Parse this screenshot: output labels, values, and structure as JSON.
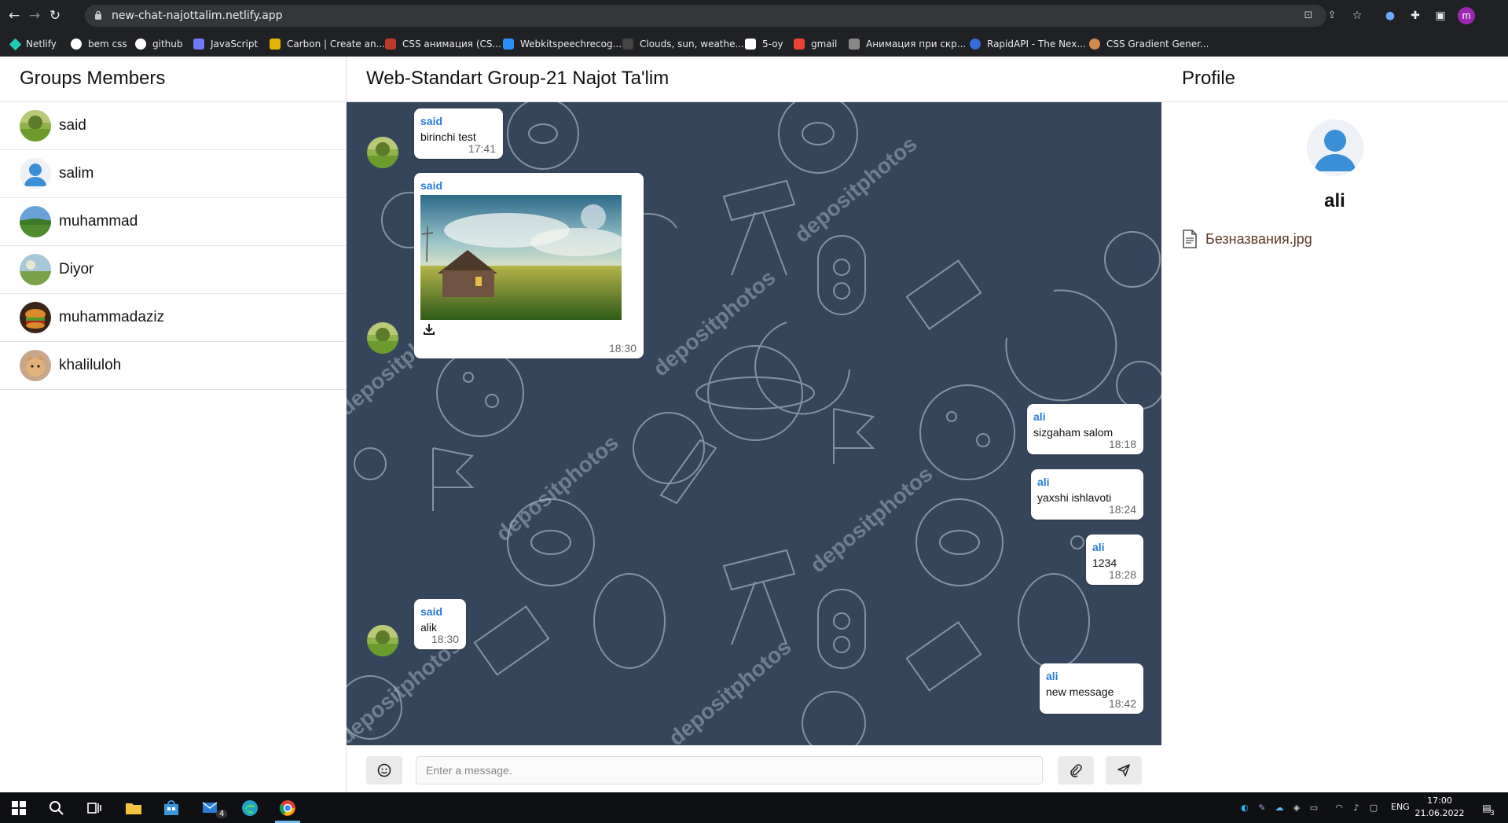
{
  "browser": {
    "url": "new-chat-najottalim.netlify.app",
    "profile_initial": "m",
    "bookmarks": [
      {
        "label": "Netlify",
        "color": "#25c7b7"
      },
      {
        "label": "bem css",
        "color": "#ffffff"
      },
      {
        "label": "github",
        "color": "#ffffff"
      },
      {
        "label": "JavaScript",
        "color": "#6f7bf7"
      },
      {
        "label": "Carbon | Create an...",
        "color": "#e0b400"
      },
      {
        "label": "CSS анимация (CS...",
        "color": "#c0392b"
      },
      {
        "label": "Webkitspeechrecog...",
        "color": "#2c8ef8"
      },
      {
        "label": "Clouds, sun, weathe...",
        "color": "#444444"
      },
      {
        "label": "5-oy",
        "color": "#ffffff"
      },
      {
        "label": "gmail",
        "color": "#ea4335"
      },
      {
        "label": "Анимация при скр...",
        "color": "#888888"
      },
      {
        "label": "RapidAPI - The Nex...",
        "color": "#3b6bd6"
      },
      {
        "label": "CSS Gradient Gener...",
        "color": "#d08a50"
      }
    ]
  },
  "members": {
    "title": "Groups Members",
    "list": [
      {
        "name": "said",
        "avatar": "landscape"
      },
      {
        "name": "salim",
        "avatar": "default-user"
      },
      {
        "name": "muhammad",
        "avatar": "landscape"
      },
      {
        "name": "Diyor",
        "avatar": "landscape"
      },
      {
        "name": "muhammadaziz",
        "avatar": "food"
      },
      {
        "name": "khaliluloh",
        "avatar": "cat"
      }
    ]
  },
  "chat": {
    "title": "Web-Standart Group-21 Najot Ta'lim",
    "input_placeholder": "Enter a message.",
    "messages": [
      {
        "author": "said",
        "text": "birinchi test",
        "time": "17:41",
        "side": "left"
      },
      {
        "author": "said",
        "text": "",
        "time": "18:30",
        "side": "left",
        "attachment": "image-house-landscape"
      },
      {
        "author": "ali",
        "text": "sizgaham salom",
        "time": "18:18",
        "side": "right"
      },
      {
        "author": "ali",
        "text": "yaxshi ishlavoti",
        "time": "18:24",
        "side": "right"
      },
      {
        "author": "ali",
        "text": "1234",
        "time": "18:28",
        "side": "right"
      },
      {
        "author": "said",
        "text": "alik",
        "time": "18:30",
        "side": "left"
      },
      {
        "author": "ali",
        "text": "new message",
        "time": "18:42",
        "side": "right"
      }
    ]
  },
  "profile": {
    "title": "Profile",
    "name": "ali",
    "files": [
      {
        "name": "Безназвания.jpg",
        "icon": "file-icon"
      }
    ]
  },
  "taskbar": {
    "language": "ENG",
    "time": "17:00",
    "date": "21.06.2022",
    "mail_badge": "4",
    "notifications": "3"
  },
  "colors": {
    "chat_bg": "#35465c",
    "author_blue": "#2a7ad9",
    "chrome_dark": "#202124"
  }
}
